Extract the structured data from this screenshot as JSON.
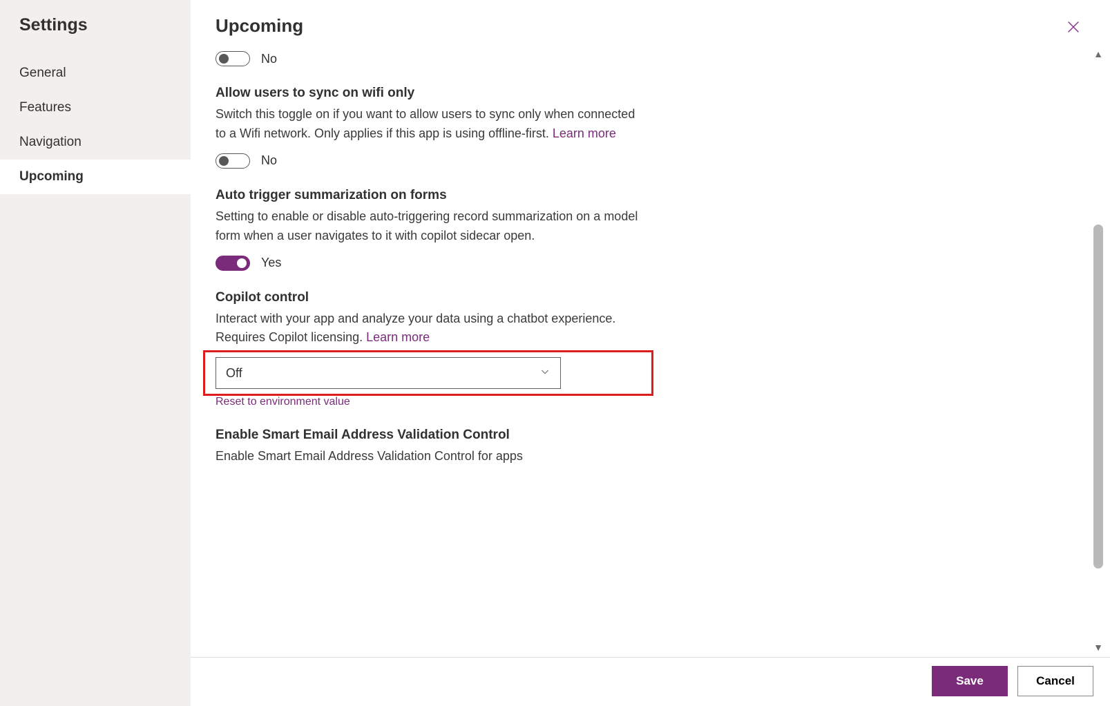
{
  "sidebar": {
    "title": "Settings",
    "items": [
      {
        "label": "General"
      },
      {
        "label": "Features"
      },
      {
        "label": "Navigation"
      },
      {
        "label": "Upcoming"
      }
    ],
    "active_index": 3
  },
  "header": {
    "title": "Upcoming"
  },
  "toggle_labels": {
    "yes": "Yes",
    "no": "No"
  },
  "settings": {
    "item0": {
      "toggle_state": "off",
      "toggle_label": "No"
    },
    "wifi_sync": {
      "title": "Allow users to sync on wifi only",
      "desc": "Switch this toggle on if you want to allow users to sync only when connected to a Wifi network. Only applies if this app is using offline-first. ",
      "learn_more": "Learn more",
      "toggle_state": "off",
      "toggle_label": "No"
    },
    "auto_summarize": {
      "title": "Auto trigger summarization on forms",
      "desc": "Setting to enable or disable auto-triggering record summarization on a model form when a user navigates to it with copilot sidecar open.",
      "toggle_state": "on",
      "toggle_label": "Yes"
    },
    "copilot": {
      "title": "Copilot control",
      "desc": "Interact with your app and analyze your data using a chatbot experience. Requires Copilot licensing. ",
      "learn_more": "Learn more",
      "selected": "Off",
      "reset_label": "Reset to environment value"
    },
    "smart_email": {
      "title": "Enable Smart Email Address Validation Control",
      "desc": "Enable Smart Email Address Validation Control for apps"
    }
  },
  "footer": {
    "save": "Save",
    "cancel": "Cancel"
  },
  "colors": {
    "accent": "#7a2b7a"
  }
}
